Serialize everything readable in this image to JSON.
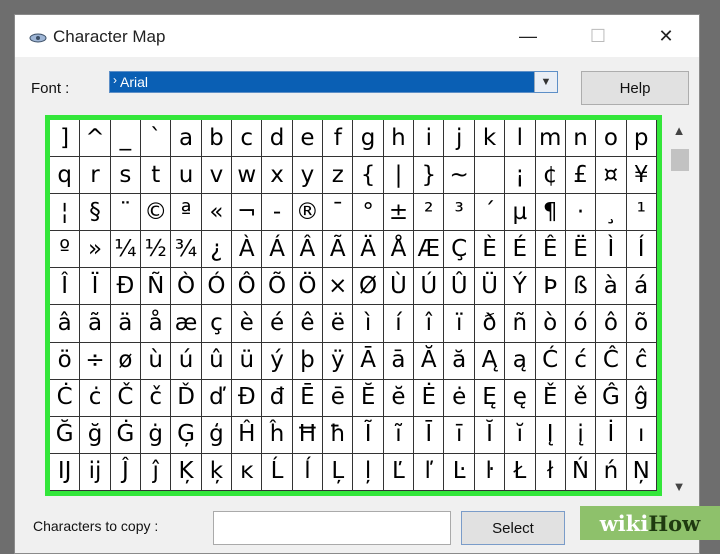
{
  "window": {
    "title": "Character Map"
  },
  "titlebar_buttons": {
    "minimize": "—",
    "maximize": "☐",
    "close": "✕"
  },
  "font": {
    "label": "Font :",
    "value": "Arial"
  },
  "help_label": "Help",
  "grid": [
    [
      "]",
      "^",
      "_",
      "`",
      "a",
      "b",
      "c",
      "d",
      "e",
      "f",
      "g",
      "h",
      "i",
      "j",
      "k",
      "l",
      "m",
      "n",
      "o",
      "p"
    ],
    [
      "q",
      "r",
      "s",
      "t",
      "u",
      "v",
      "w",
      "x",
      "y",
      "z",
      "{",
      "|",
      "}",
      "~",
      "",
      "¡",
      "¢",
      "£",
      "¤",
      "¥"
    ],
    [
      "¦",
      "§",
      "¨",
      "©",
      "ª",
      "«",
      "¬",
      "-",
      "®",
      "¯",
      "°",
      "±",
      "²",
      "³",
      "´",
      "µ",
      "¶",
      "·",
      "¸",
      "¹"
    ],
    [
      "º",
      "»",
      "¼",
      "½",
      "¾",
      "¿",
      "À",
      "Á",
      "Â",
      "Ã",
      "Ä",
      "Å",
      "Æ",
      "Ç",
      "È",
      "É",
      "Ê",
      "Ë",
      "Ì",
      "Í"
    ],
    [
      "Î",
      "Ï",
      "Ð",
      "Ñ",
      "Ò",
      "Ó",
      "Ô",
      "Õ",
      "Ö",
      "×",
      "Ø",
      "Ù",
      "Ú",
      "Û",
      "Ü",
      "Ý",
      "Þ",
      "ß",
      "à",
      "á"
    ],
    [
      "â",
      "ã",
      "ä",
      "å",
      "æ",
      "ç",
      "è",
      "é",
      "ê",
      "ë",
      "ì",
      "í",
      "î",
      "ï",
      "ð",
      "ñ",
      "ò",
      "ó",
      "ô",
      "õ"
    ],
    [
      "ö",
      "÷",
      "ø",
      "ù",
      "ú",
      "û",
      "ü",
      "ý",
      "þ",
      "ÿ",
      "Ā",
      "ā",
      "Ă",
      "ă",
      "Ą",
      "ą",
      "Ć",
      "ć",
      "Ĉ",
      "ĉ"
    ],
    [
      "Ċ",
      "ċ",
      "Č",
      "č",
      "Ď",
      "ď",
      "Đ",
      "đ",
      "Ē",
      "ē",
      "Ĕ",
      "ĕ",
      "Ė",
      "ė",
      "Ę",
      "ę",
      "Ě",
      "ě",
      "Ĝ",
      "ĝ"
    ],
    [
      "Ğ",
      "ğ",
      "Ġ",
      "ġ",
      "Ģ",
      "ģ",
      "Ĥ",
      "ĥ",
      "Ħ",
      "ħ",
      "Ĩ",
      "ĩ",
      "Ī",
      "ī",
      "Ĭ",
      "ĭ",
      "Į",
      "į",
      "İ",
      "ı"
    ],
    [
      "Ĳ",
      "ĳ",
      "Ĵ",
      "ĵ",
      "Ķ",
      "ķ",
      "ĸ",
      "Ĺ",
      "ĺ",
      "Ļ",
      "ļ",
      "Ľ",
      "ľ",
      "Ŀ",
      "ŀ",
      "Ł",
      "ł",
      "Ń",
      "ń",
      "Ņ"
    ]
  ],
  "copy": {
    "label": "Characters to copy :",
    "value": ""
  },
  "select_label": "Select",
  "watermark": {
    "part1": "wiki",
    "part2": "How"
  },
  "colors": {
    "highlight": "#33e63a",
    "selection": "#0a5fb4",
    "watermark": "#8ec16b"
  },
  "icons": {
    "app": "character-map-icon",
    "dropdown": "chevron-down-icon",
    "scroll_up": "chevron-up-icon",
    "scroll_down": "chevron-down-icon"
  }
}
